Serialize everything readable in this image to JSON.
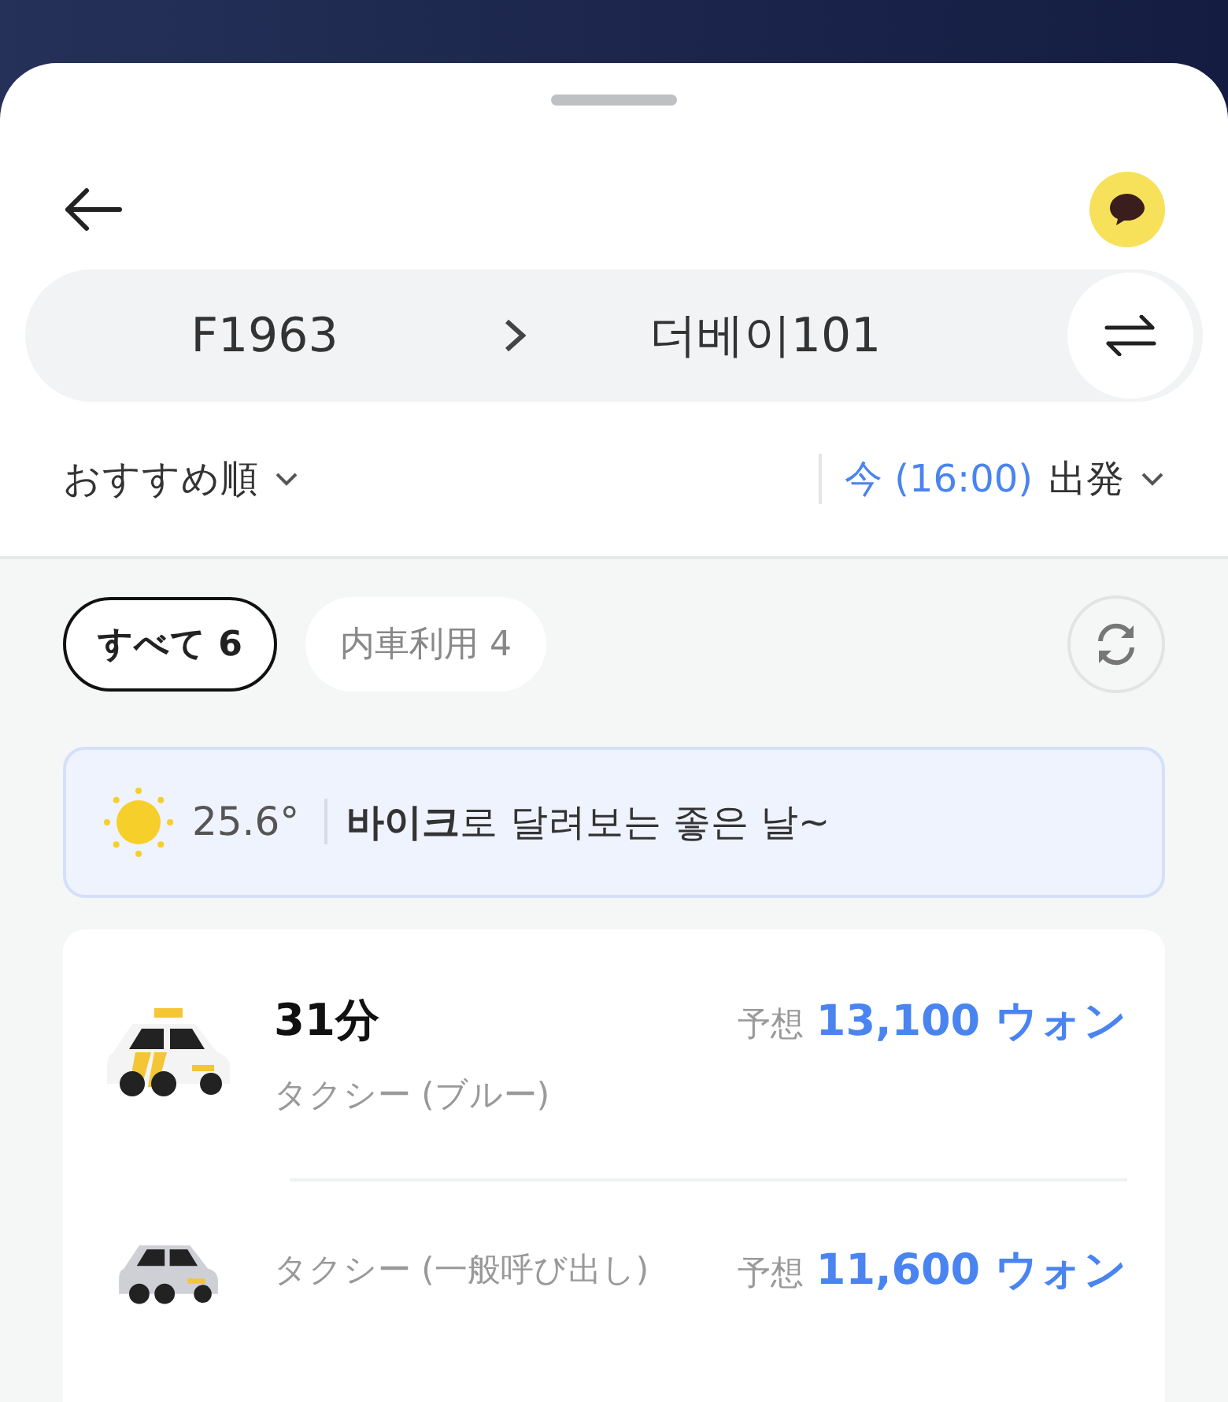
{
  "route": {
    "origin": "F1963",
    "destination": "더베이101"
  },
  "sort": {
    "label": "おすすめ順"
  },
  "departure": {
    "time": "今 (16:00)",
    "label": "出発"
  },
  "filters": [
    {
      "label": "すべて 6",
      "selected": true
    },
    {
      "label": "内車利用 4",
      "selected": false
    }
  ],
  "weather": {
    "temperature": "25.6°",
    "message": "**바이크**로 달려보는 좋은 날~"
  },
  "options": [
    {
      "kind": "taxi-premium",
      "time": "31分",
      "name": "タクシー (ブルー)",
      "price_label": "予想",
      "price": "13,100 ウォン"
    },
    {
      "kind": "taxi-standard",
      "name": "タクシー (一般呼び出し)",
      "price_label": "予想",
      "price": "11,600 ウォン"
    }
  ]
}
